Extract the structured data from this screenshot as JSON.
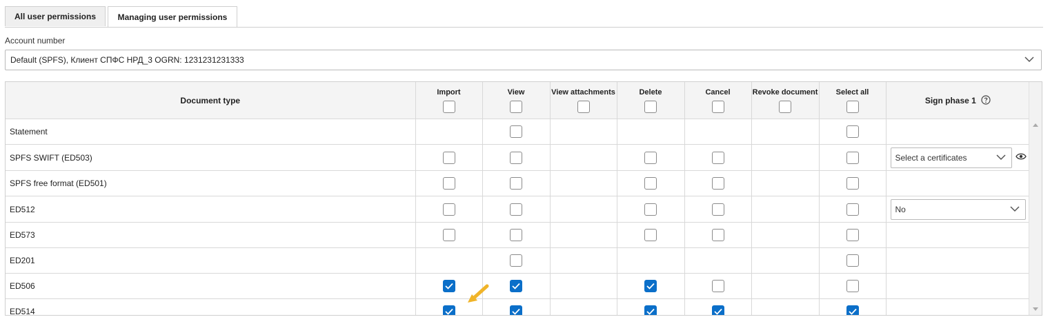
{
  "tabs": [
    "All user permissions",
    "Managing user permissions"
  ],
  "account": {
    "label": "Account number",
    "value": "Default (SPFS), Клиент СПФС НРД_3 OGRN: 1231231231333"
  },
  "columns": {
    "document_type": "Document type",
    "import": "Import",
    "view": "View",
    "view_attachments": "View attachments",
    "delete": "Delete",
    "cancel": "Cancel",
    "revoke": "Revoke document",
    "select_all": "Select all",
    "sign_phase": "Sign phase 1"
  },
  "rows": [
    {
      "name": "Statement",
      "import": null,
      "view": false,
      "view_attachments": null,
      "delete": null,
      "cancel": null,
      "revoke": null,
      "select_all": false,
      "sign": ""
    },
    {
      "name": "SPFS SWIFT (ED503)",
      "import": false,
      "view": false,
      "view_attachments": null,
      "delete": false,
      "cancel": false,
      "revoke": null,
      "select_all": false,
      "sign": "Select a certificates"
    },
    {
      "name": "SPFS free format (ED501)",
      "import": false,
      "view": false,
      "view_attachments": null,
      "delete": false,
      "cancel": false,
      "revoke": null,
      "select_all": false,
      "sign": ""
    },
    {
      "name": "ED512",
      "import": false,
      "view": false,
      "view_attachments": null,
      "delete": false,
      "cancel": false,
      "revoke": null,
      "select_all": false,
      "sign": "No"
    },
    {
      "name": "ED573",
      "import": false,
      "view": false,
      "view_attachments": null,
      "delete": false,
      "cancel": false,
      "revoke": null,
      "select_all": false,
      "sign": ""
    },
    {
      "name": "ED201",
      "import": null,
      "view": false,
      "view_attachments": null,
      "delete": null,
      "cancel": null,
      "revoke": null,
      "select_all": false,
      "sign": ""
    },
    {
      "name": "ED506",
      "import": true,
      "view": true,
      "view_attachments": null,
      "delete": true,
      "cancel": false,
      "revoke": null,
      "select_all": false,
      "sign": ""
    },
    {
      "name": "ED514",
      "import": true,
      "view": true,
      "view_attachments": null,
      "delete": true,
      "cancel": true,
      "revoke": null,
      "select_all": true,
      "sign": ""
    }
  ],
  "colors": {
    "accent": "#0b6fc9",
    "pointer": "#f0b429"
  },
  "icons": [
    "chevron-down-icon",
    "eye-icon",
    "help-icon",
    "check-icon",
    "pointer-arrow-icon"
  ]
}
